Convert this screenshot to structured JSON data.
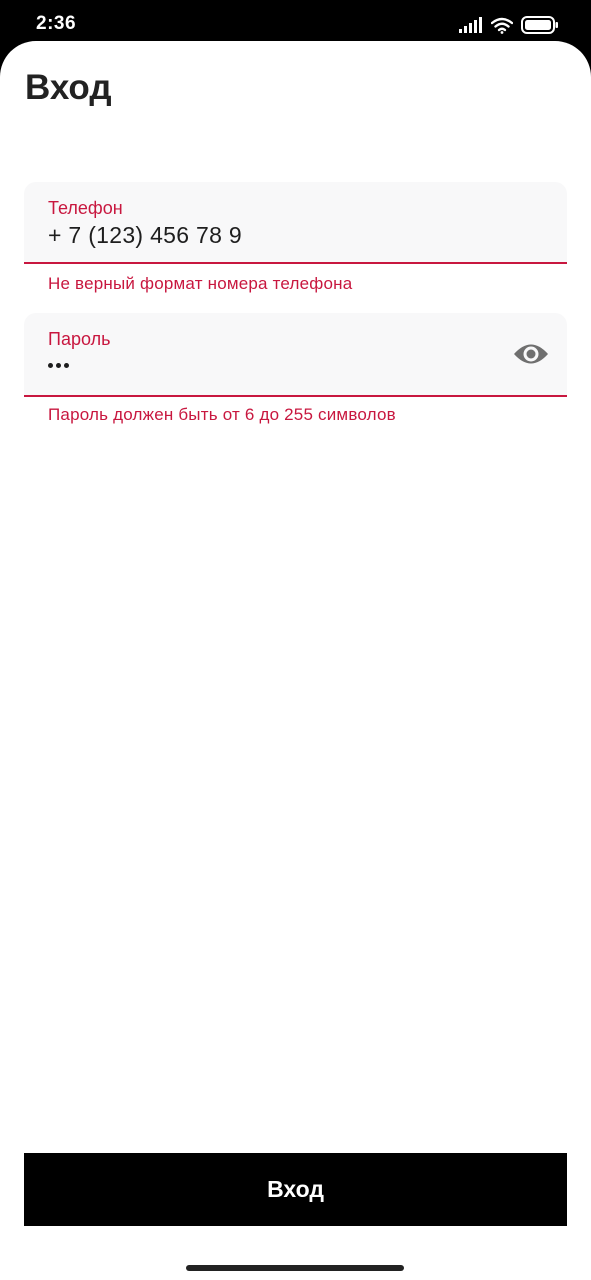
{
  "status_bar": {
    "time": "2:36",
    "icons": [
      "signal-icon",
      "wifi-icon",
      "battery-icon"
    ]
  },
  "page": {
    "title": "Вход"
  },
  "form": {
    "phone": {
      "label": "Телефон",
      "value": "+ 7 (123) 456 78 9",
      "error": "Не верный формат номера телефона"
    },
    "password": {
      "label": "Пароль",
      "masked_length": 3,
      "toggle_icon": "eye-icon",
      "error": "Пароль должен быть от 6 до 255 символов"
    }
  },
  "actions": {
    "login_label": "Вход"
  },
  "colors": {
    "accent": "#c8173f",
    "field_bg": "#f8f8f9",
    "button_bg": "#000000",
    "button_text": "#ffffff"
  }
}
